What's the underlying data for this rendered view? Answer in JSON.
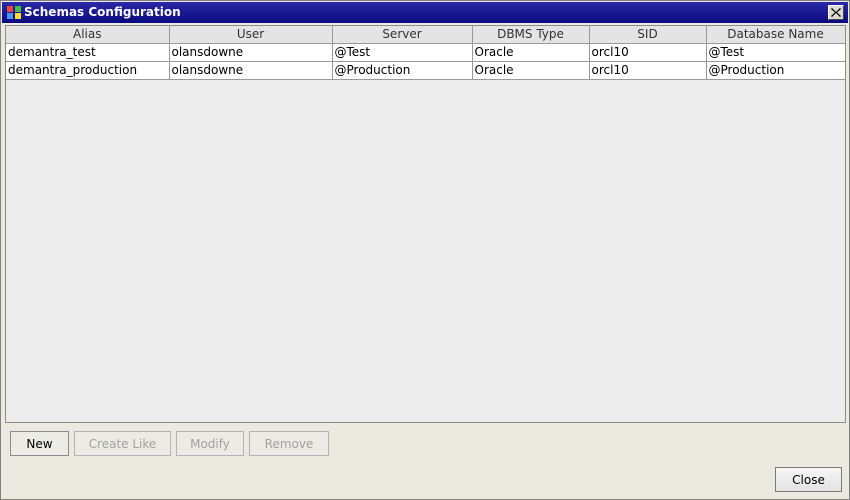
{
  "window": {
    "title": "Schemas Configuration"
  },
  "table": {
    "columns": [
      "Alias",
      "User",
      "Server",
      "DBMS Type",
      "SID",
      "Database Name"
    ],
    "rows": [
      [
        "demantra_test",
        "olansdowne",
        "@Test",
        "Oracle",
        "orcl10",
        "@Test"
      ],
      [
        "demantra_production",
        "olansdowne",
        "@Production",
        "Oracle",
        "orcl10",
        "@Production"
      ]
    ]
  },
  "buttons": {
    "new": "New",
    "create_like": "Create Like",
    "modify": "Modify",
    "remove": "Remove",
    "close": "Close"
  },
  "icons": {
    "app": "app-window-icon",
    "close": "close-icon"
  },
  "colors": {
    "titlebar": "#0a0a7e",
    "background": "#ece9e0"
  }
}
